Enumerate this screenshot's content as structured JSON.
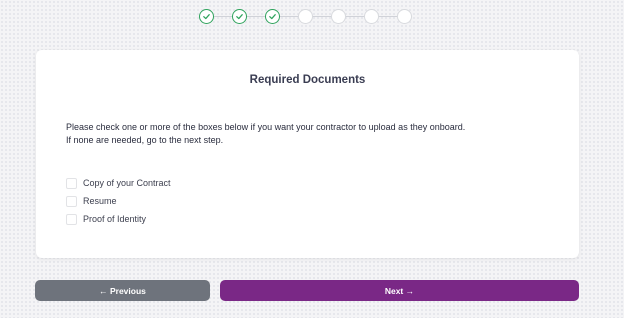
{
  "stepper": {
    "steps": [
      {
        "status": "completed",
        "icon": "check-icon"
      },
      {
        "status": "completed",
        "icon": "check-icon"
      },
      {
        "status": "completed",
        "icon": "check-icon"
      },
      {
        "status": "pending"
      },
      {
        "status": "pending"
      },
      {
        "status": "pending"
      },
      {
        "status": "pending"
      }
    ],
    "completed_color": "#2fa35d"
  },
  "card": {
    "title": "Required Documents",
    "instruction_line1": "Please check one or more of the boxes below if you want your contractor to upload as they onboard.",
    "instruction_line2": "If none are needed, go to the next step.",
    "options": [
      {
        "label": "Copy of your Contract",
        "checked": false
      },
      {
        "label": "Resume",
        "checked": false
      },
      {
        "label": "Proof of Identity",
        "checked": false
      }
    ]
  },
  "buttons": {
    "previous_label": "← Previous",
    "next_label": "Next →",
    "previous_color": "#6e737c",
    "next_color": "#7a2886"
  }
}
